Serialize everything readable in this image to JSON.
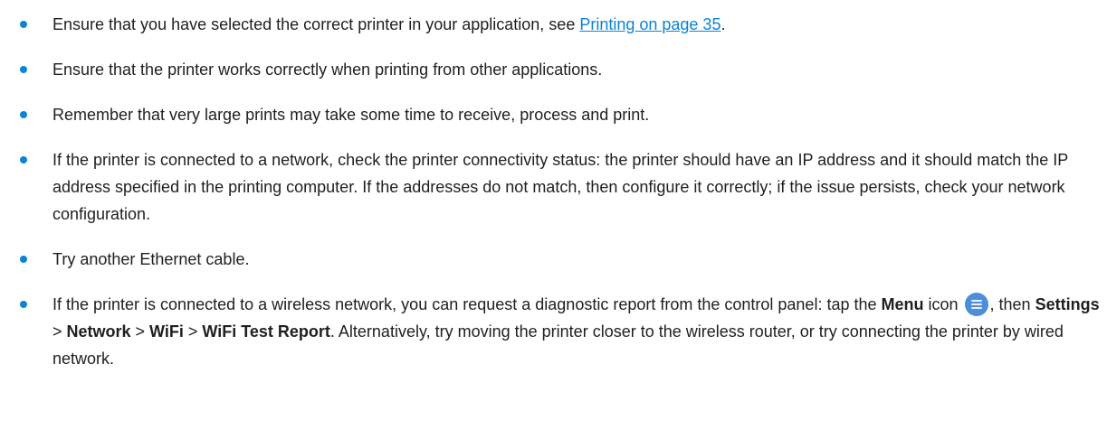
{
  "colors": {
    "bullet": "#0a84d6",
    "link": "#0a84d6",
    "text": "#1f1f1f",
    "menu_icon_bg": "#4d8dd9"
  },
  "items": [
    {
      "before": "Ensure that you have selected the correct printer in your application, see ",
      "link": "Printing on page 35",
      "after": "."
    },
    {
      "text": "Ensure that the printer works correctly when printing from other applications."
    },
    {
      "text": "Remember that very large prints may take some time to receive, process and print."
    },
    {
      "text": "If the printer is connected to a network, check the printer connectivity status: the printer should have an IP address and it should match the IP address specified in the printing computer. If the addresses do not match, then configure it correctly; if the issue persists, check your network configuration."
    },
    {
      "text": "Try another Ethernet cable."
    },
    {
      "t1": "If the printer is connected to a wireless network, you can request a diagnostic report from the control panel: tap the ",
      "menu": "Menu",
      "t2": " icon ",
      "menu_icon": "menu-icon",
      "t3": ", then ",
      "settings": "Settings",
      "sep1": " > ",
      "network": "Network",
      "sep2": " > ",
      "wifi": "WiFi",
      "sep3": " > ",
      "wifi_report": "WiFi Test Report",
      "t4": ". Alternatively, try moving the printer closer to the wireless router, or try connecting the printer by wired network."
    }
  ]
}
